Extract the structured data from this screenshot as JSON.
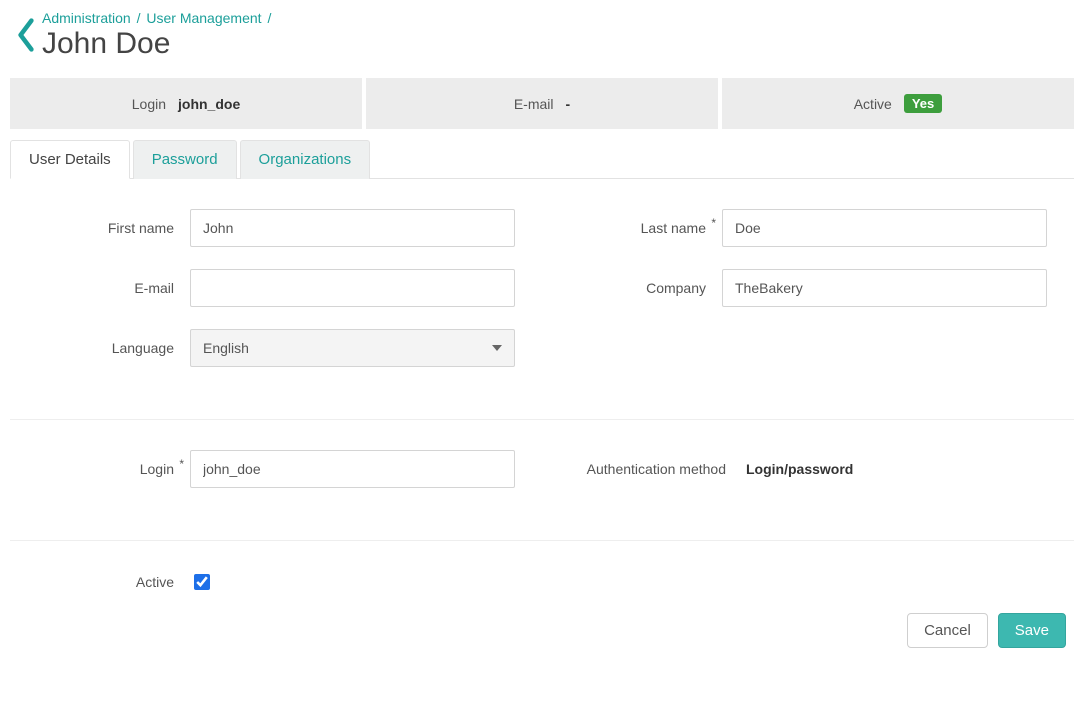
{
  "breadcrumb": {
    "admin": "Administration",
    "user_mgmt": "User Management"
  },
  "page_title": "John Doe",
  "summary": {
    "login_label": "Login",
    "login_value": "john_doe",
    "email_label": "E-mail",
    "email_value": "-",
    "active_label": "Active",
    "active_value": "Yes"
  },
  "tabs": {
    "details": "User Details",
    "password": "Password",
    "organizations": "Organizations"
  },
  "form": {
    "first_name_label": "First name",
    "first_name_value": "John",
    "last_name_label": "Last name",
    "last_name_value": "Doe",
    "email_label": "E-mail",
    "email_value": "",
    "company_label": "Company",
    "company_value": "TheBakery",
    "language_label": "Language",
    "language_value": "English",
    "login_label": "Login",
    "login_value": "john_doe",
    "auth_method_label": "Authentication method",
    "auth_method_value": "Login/password",
    "active_label": "Active",
    "active_checked": true
  },
  "actions": {
    "cancel": "Cancel",
    "save": "Save"
  }
}
